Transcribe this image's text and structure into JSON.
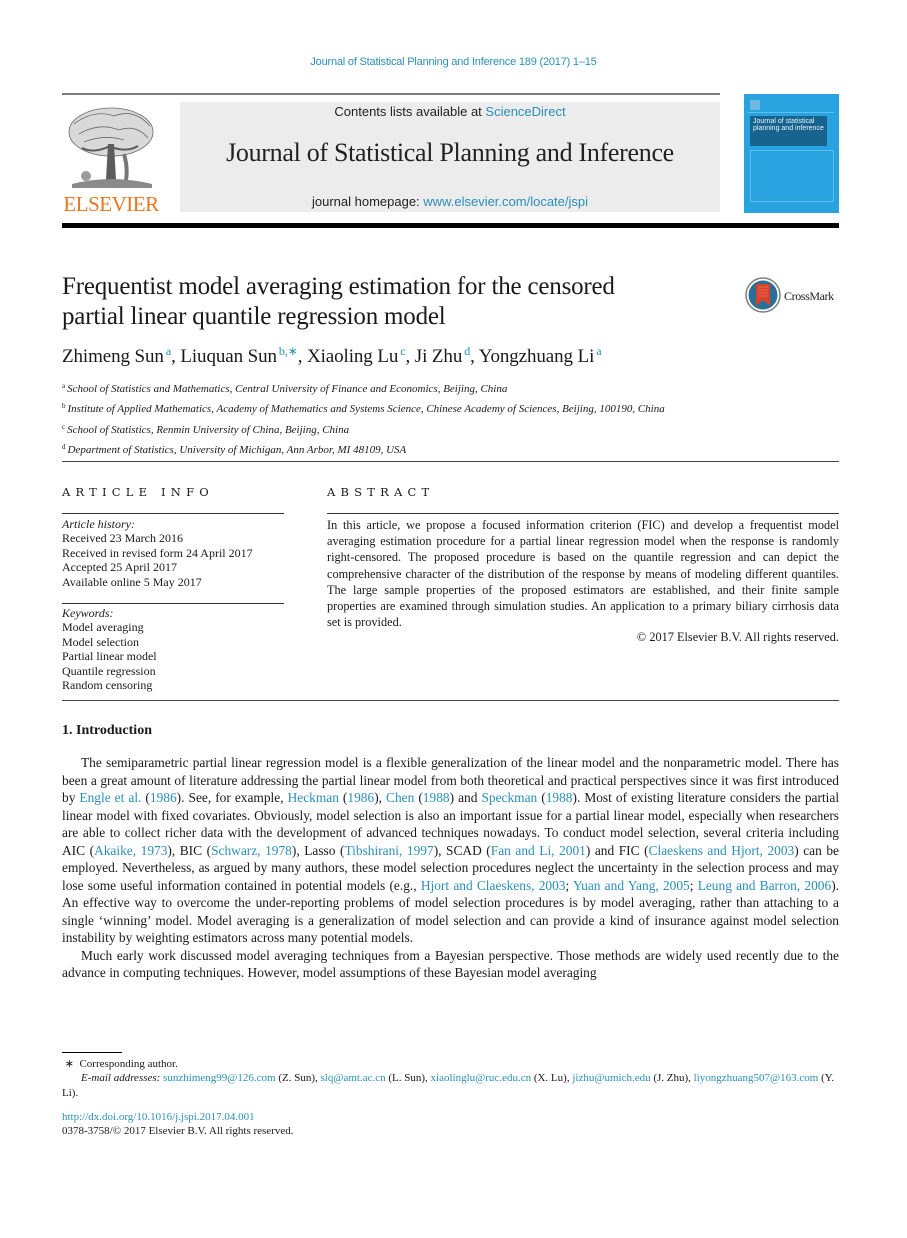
{
  "running_head": "Journal of Statistical Planning and Inference 189 (2017) 1–15",
  "masthead": {
    "contents_prefix": "Contents lists available at ",
    "contents_link": "ScienceDirect",
    "journal_name": "Journal of Statistical Planning and Inference",
    "homepage_prefix": "journal homepage: ",
    "homepage_link": "www.elsevier.com/locate/jspi",
    "publisher_logo_text": "ELSEVIER",
    "cover_title": "Journal of statistical planning and inference",
    "colors": {
      "link": "#2a8fb8",
      "elsevier_orange": "#e8761e",
      "cover_blue": "#29a3e0",
      "cover_dark": "#17648f",
      "masthead_bg": "#ececec"
    }
  },
  "article": {
    "title_line1": "Frequentist model averaging estimation for the censored",
    "title_line2": "partial linear quantile regression model",
    "crossmark_label": "CrossMark",
    "authors": [
      {
        "name": "Zhimeng Sun",
        "sup": "a"
      },
      {
        "name": "Liuquan Sun",
        "sup": "b,∗"
      },
      {
        "name": "Xiaoling Lu",
        "sup": "c"
      },
      {
        "name": "Ji Zhu",
        "sup": "d"
      },
      {
        "name": "Yongzhuang Li",
        "sup": "a"
      }
    ],
    "affiliations": [
      {
        "sup": "a",
        "text": "School of Statistics and Mathematics, Central University of Finance and Economics, Beijing, China"
      },
      {
        "sup": "b",
        "text": "Institute of Applied Mathematics, Academy of Mathematics and Systems Science, Chinese Academy of Sciences, Beijing, 100190, China"
      },
      {
        "sup": "c",
        "text": "School of Statistics, Renmin University of China, Beijing, China"
      },
      {
        "sup": "d",
        "text": "Department of Statistics, University of Michigan, Ann Arbor, MI 48109, USA"
      }
    ]
  },
  "article_info": {
    "heading": "ARTICLE INFO",
    "history_label": "Article history:",
    "history": [
      "Received 23 March 2016",
      "Received in revised form 24 April 2017",
      "Accepted 25 April 2017",
      "Available online 5 May 2017"
    ],
    "keywords_label": "Keywords:",
    "keywords": [
      "Model averaging",
      "Model selection",
      "Partial linear model",
      "Quantile regression",
      "Random censoring"
    ]
  },
  "abstract": {
    "heading": "ABSTRACT",
    "text": "In this article, we propose a focused information criterion (FIC) and develop a frequentist model averaging estimation procedure for a partial linear regression model when the response is randomly right-censored. The proposed procedure is based on the quantile regression and can depict the comprehensive character of the distribution of the response by means of modeling different quantiles. The large sample properties of the proposed estimators are established, and their finite sample properties are examined through simulation studies. An application to a primary biliary cirrhosis data set is provided.",
    "copyright": "© 2017 Elsevier B.V. All rights reserved."
  },
  "introduction": {
    "heading": "1.  Introduction",
    "p1": [
      {
        "t": "The semiparametric partial linear regression model is a flexible generalization of the linear model and the nonparametric model. There has been a great amount of literature addressing the partial linear model from both theoretical and practical perspectives since it was first introduced by "
      },
      {
        "t": "Engle et al.",
        "link": true
      },
      {
        "t": " ("
      },
      {
        "t": "1986",
        "link": true
      },
      {
        "t": "). See, for example, "
      },
      {
        "t": "Heckman",
        "link": true
      },
      {
        "t": " ("
      },
      {
        "t": "1986",
        "link": true
      },
      {
        "t": "), "
      },
      {
        "t": "Chen",
        "link": true
      },
      {
        "t": " ("
      },
      {
        "t": "1988",
        "link": true
      },
      {
        "t": ") and "
      },
      {
        "t": "Speckman",
        "link": true
      },
      {
        "t": " ("
      },
      {
        "t": "1988",
        "link": true
      },
      {
        "t": "). Most of existing literature considers the partial linear model with fixed covariates. Obviously, model selection is also an important issue for a partial linear model, especially when researchers are able to collect richer data with the development of advanced techniques nowadays. To conduct model selection, several criteria including AIC ("
      },
      {
        "t": "Akaike, 1973",
        "link": true
      },
      {
        "t": "), BIC ("
      },
      {
        "t": "Schwarz, 1978",
        "link": true
      },
      {
        "t": "), Lasso ("
      },
      {
        "t": "Tibshirani, 1997",
        "link": true
      },
      {
        "t": "), SCAD ("
      },
      {
        "t": "Fan and Li, 2001",
        "link": true
      },
      {
        "t": ") and FIC ("
      },
      {
        "t": "Claeskens and Hjort, 2003",
        "link": true
      },
      {
        "t": ") can be employed. Nevertheless, as argued by many authors, these model selection procedures neglect the uncertainty in the selection process and may lose some useful information contained in potential models (e.g., "
      },
      {
        "t": "Hjort and Claeskens, 2003",
        "link": true
      },
      {
        "t": "; "
      },
      {
        "t": "Yuan and Yang, 2005",
        "link": true
      },
      {
        "t": "; "
      },
      {
        "t": "Leung and Barron, 2006",
        "link": true
      },
      {
        "t": "). An effective way to overcome the under-reporting problems of model selection procedures is by model averaging, rather than attaching to a single ‘winning’ model. Model averaging is a generalization of model selection and can provide a kind of insurance against model selection instability by weighting estimators across many potential models."
      }
    ],
    "p2": "Much early work discussed model averaging techniques from a Bayesian perspective. Those methods are widely used recently due to the advance in computing techniques. However, model assumptions of these Bayesian model averaging"
  },
  "footnotes": {
    "star": "∗",
    "corresponding": "Corresponding author.",
    "emails_label": "E-mail addresses:",
    "emails": [
      {
        "email": "sunzhimeng99@126.com",
        "who": " (Z. Sun), "
      },
      {
        "email": "slq@amt.ac.cn",
        "who": " (L. Sun), "
      },
      {
        "email": "xiaolinglu@ruc.edu.cn",
        "who": " (X. Lu), "
      },
      {
        "email": "jizhu@umich.edu",
        "who": " (J. Zhu), "
      },
      {
        "email": "liyongzhuang507@163.com",
        "who": " (Y. Li)."
      }
    ],
    "doi": "http://dx.doi.org/10.1016/j.jspi.2017.04.001",
    "issn_copyright": "0378-3758/© 2017 Elsevier B.V. All rights reserved."
  }
}
